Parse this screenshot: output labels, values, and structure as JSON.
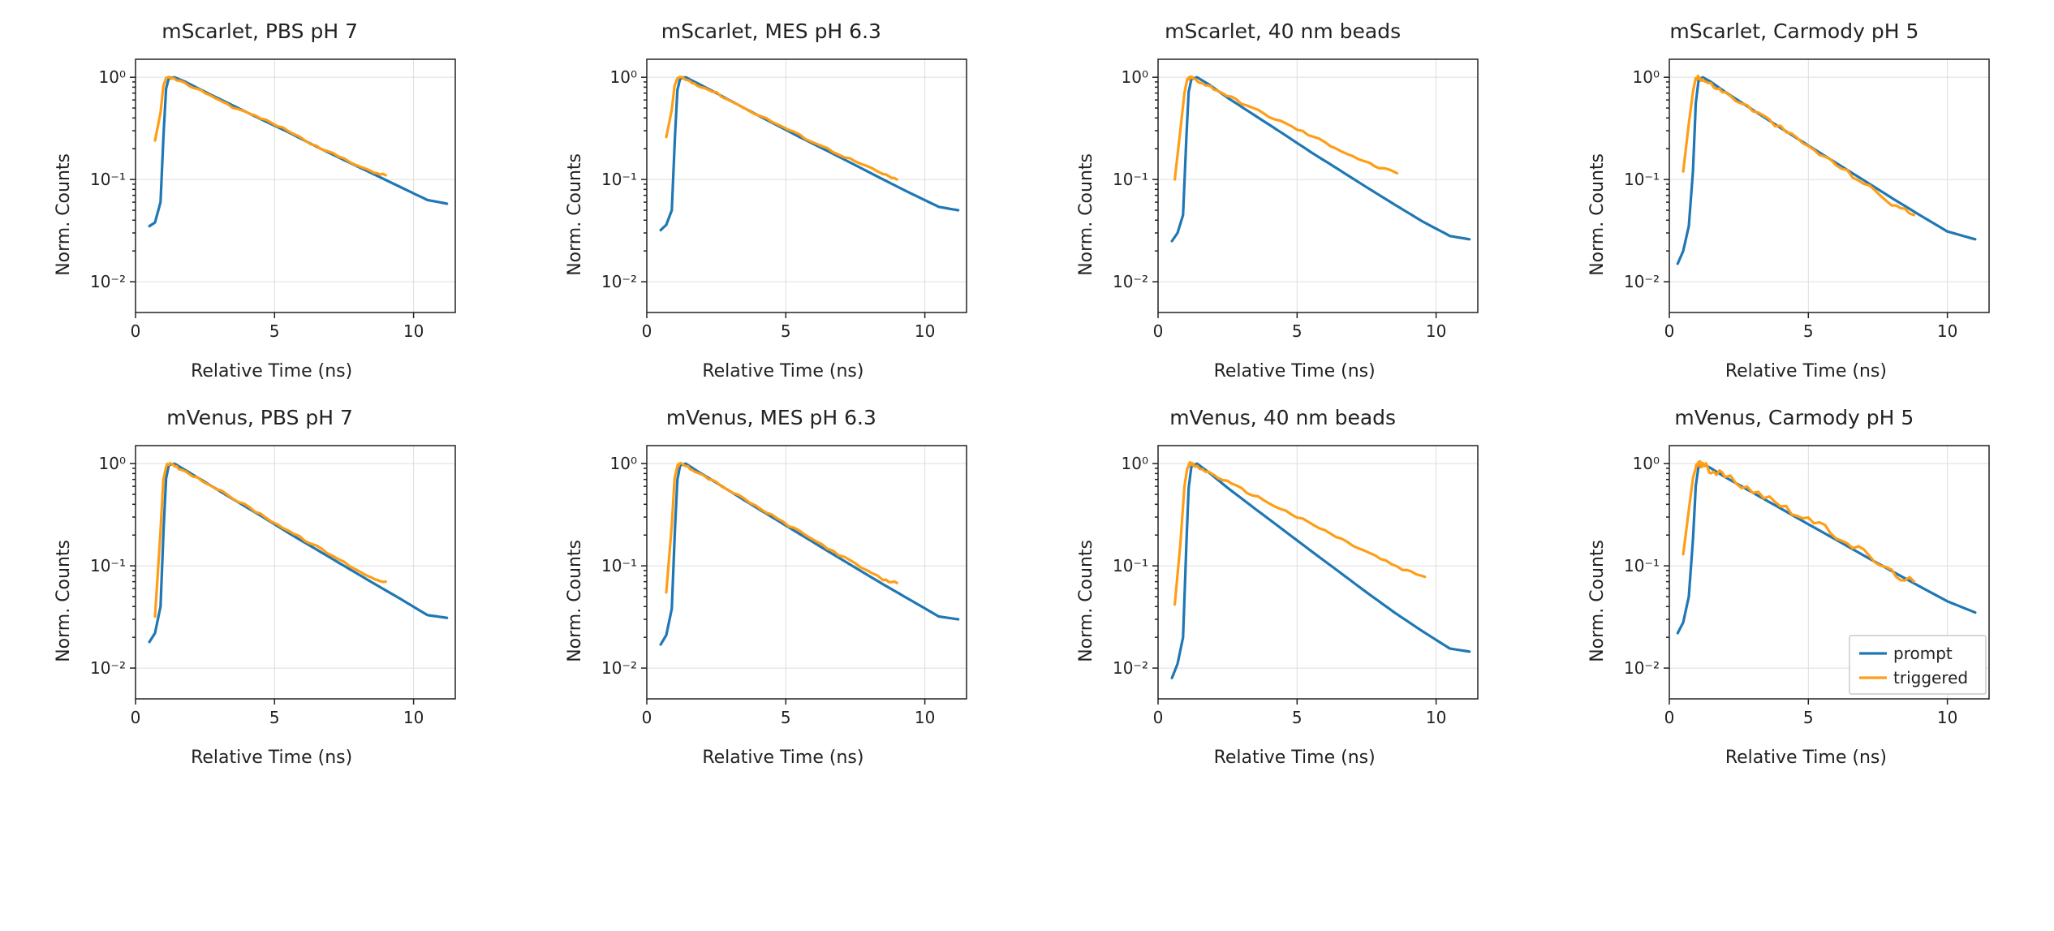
{
  "layout": {
    "rows": 2,
    "cols": 4
  },
  "common": {
    "xlabel": "Relative Time (ns)",
    "ylabel": "Norm. Counts",
    "xlim": [
      0,
      11.5
    ],
    "ylim": [
      0.005,
      1.5
    ],
    "yscale": "log",
    "xticks": [
      0,
      5,
      10
    ],
    "ytick_labels": [
      "10⁻²",
      "10⁻¹",
      "10⁰"
    ],
    "ytick_values": [
      0.01,
      0.1,
      1.0
    ]
  },
  "colors": {
    "prompt": "#1f77b4",
    "triggered": "#ff9e16"
  },
  "legend": {
    "panel_index": 7,
    "items": [
      "prompt",
      "triggered"
    ]
  },
  "chart_data": [
    {
      "title": "mScarlet, PBS pH 7",
      "type": "line",
      "xlabel": "Relative Time (ns)",
      "ylabel": "Norm. Counts",
      "xlim": [
        0,
        11.5
      ],
      "ylim": [
        0.005,
        1.5
      ],
      "yscale": "log",
      "series": [
        {
          "name": "prompt",
          "x": [
            0.5,
            0.7,
            0.9,
            1.0,
            1.1,
            1.2,
            1.4,
            1.8,
            2.5,
            3.5,
            4.5,
            5.5,
            6.5,
            7.5,
            8.5,
            9.5,
            10.5,
            11.2
          ],
          "y": [
            0.035,
            0.038,
            0.06,
            0.25,
            0.78,
            0.98,
            1.0,
            0.9,
            0.72,
            0.53,
            0.39,
            0.29,
            0.21,
            0.155,
            0.115,
            0.085,
            0.063,
            0.058
          ]
        },
        {
          "name": "triggered",
          "x": [
            0.7,
            0.9,
            1.0,
            1.1,
            1.2,
            1.4,
            1.8,
            2.5,
            3.5,
            4.5,
            5.5,
            6.5,
            7.5,
            8.5,
            9.0
          ],
          "y": [
            0.24,
            0.45,
            0.82,
            0.97,
            1.0,
            0.96,
            0.86,
            0.71,
            0.51,
            0.4,
            0.3,
            0.21,
            0.16,
            0.118,
            0.11
          ],
          "noise": 0.02
        }
      ]
    },
    {
      "title": "mScarlet, MES pH 6.3",
      "type": "line",
      "xlabel": "Relative Time (ns)",
      "ylabel": "Norm. Counts",
      "xlim": [
        0,
        11.5
      ],
      "ylim": [
        0.005,
        1.5
      ],
      "yscale": "log",
      "series": [
        {
          "name": "prompt",
          "x": [
            0.5,
            0.7,
            0.9,
            1.0,
            1.1,
            1.2,
            1.4,
            1.8,
            2.5,
            3.5,
            4.5,
            5.5,
            6.5,
            7.5,
            8.5,
            9.5,
            10.5,
            11.2
          ],
          "y": [
            0.032,
            0.036,
            0.05,
            0.22,
            0.75,
            0.97,
            1.0,
            0.88,
            0.7,
            0.5,
            0.36,
            0.26,
            0.19,
            0.138,
            0.1,
            0.073,
            0.054,
            0.05
          ]
        },
        {
          "name": "triggered",
          "x": [
            0.7,
            0.9,
            1.0,
            1.1,
            1.2,
            1.4,
            1.8,
            2.5,
            3.5,
            4.5,
            5.5,
            6.5,
            7.5,
            8.5,
            9.0
          ],
          "y": [
            0.26,
            0.48,
            0.83,
            0.97,
            1.0,
            0.95,
            0.85,
            0.7,
            0.5,
            0.37,
            0.27,
            0.2,
            0.15,
            0.113,
            0.1
          ],
          "noise": 0.025
        }
      ]
    },
    {
      "title": "mScarlet, 40 nm beads",
      "type": "line",
      "xlabel": "Relative Time (ns)",
      "ylabel": "Norm. Counts",
      "xlim": [
        0,
        11.5
      ],
      "ylim": [
        0.005,
        1.5
      ],
      "yscale": "log",
      "series": [
        {
          "name": "prompt",
          "x": [
            0.5,
            0.7,
            0.9,
            1.0,
            1.1,
            1.2,
            1.4,
            1.8,
            2.5,
            3.5,
            4.5,
            5.5,
            6.5,
            7.5,
            8.5,
            9.5,
            10.5,
            11.2
          ],
          "y": [
            0.025,
            0.03,
            0.045,
            0.2,
            0.72,
            0.96,
            1.0,
            0.86,
            0.63,
            0.42,
            0.28,
            0.185,
            0.125,
            0.084,
            0.057,
            0.039,
            0.028,
            0.026
          ]
        },
        {
          "name": "triggered",
          "x": [
            0.6,
            0.8,
            0.95,
            1.05,
            1.15,
            1.25,
            1.5,
            2.0,
            2.8,
            3.8,
            4.8,
            5.8,
            6.8,
            7.8,
            8.6
          ],
          "y": [
            0.1,
            0.3,
            0.7,
            0.94,
            1.0,
            0.98,
            0.9,
            0.78,
            0.6,
            0.44,
            0.33,
            0.245,
            0.18,
            0.135,
            0.115
          ],
          "noise": 0.03
        }
      ]
    },
    {
      "title": "mScarlet, Carmody pH 5",
      "type": "line",
      "xlabel": "Relative Time (ns)",
      "ylabel": "Norm. Counts",
      "xlim": [
        0,
        11.5
      ],
      "ylim": [
        0.005,
        1.5
      ],
      "yscale": "log",
      "series": [
        {
          "name": "prompt",
          "x": [
            0.3,
            0.5,
            0.7,
            0.85,
            0.95,
            1.05,
            1.2,
            1.5,
            2.0,
            3.0,
            4.0,
            5.0,
            6.0,
            7.0,
            8.0,
            9.0,
            10.0,
            11.0
          ],
          "y": [
            0.015,
            0.02,
            0.035,
            0.12,
            0.55,
            0.93,
            1.0,
            0.9,
            0.72,
            0.48,
            0.32,
            0.215,
            0.145,
            0.098,
            0.066,
            0.045,
            0.031,
            0.026
          ]
        },
        {
          "name": "triggered",
          "x": [
            0.5,
            0.7,
            0.85,
            0.95,
            1.05,
            1.2,
            1.5,
            2.0,
            3.0,
            4.0,
            5.0,
            6.0,
            7.0,
            8.0,
            8.8
          ],
          "y": [
            0.12,
            0.35,
            0.72,
            0.95,
            1.0,
            0.95,
            0.85,
            0.7,
            0.48,
            0.32,
            0.21,
            0.14,
            0.092,
            0.058,
            0.045
          ],
          "noise": 0.05
        }
      ]
    },
    {
      "title": "mVenus, PBS pH 7",
      "type": "line",
      "xlabel": "Relative Time (ns)",
      "ylabel": "Norm. Counts",
      "xlim": [
        0,
        11.5
      ],
      "ylim": [
        0.005,
        1.5
      ],
      "yscale": "log",
      "series": [
        {
          "name": "prompt",
          "x": [
            0.5,
            0.7,
            0.9,
            1.0,
            1.1,
            1.2,
            1.4,
            1.8,
            2.5,
            3.5,
            4.5,
            5.5,
            6.5,
            7.5,
            8.5,
            9.5,
            10.5,
            11.2
          ],
          "y": [
            0.018,
            0.022,
            0.04,
            0.2,
            0.72,
            0.97,
            1.0,
            0.86,
            0.66,
            0.45,
            0.31,
            0.21,
            0.145,
            0.1,
            0.069,
            0.048,
            0.033,
            0.031
          ]
        },
        {
          "name": "triggered",
          "x": [
            0.7,
            0.9,
            1.0,
            1.1,
            1.2,
            1.4,
            1.8,
            2.5,
            3.5,
            4.5,
            5.5,
            6.5,
            7.5,
            8.5,
            9.0
          ],
          "y": [
            0.032,
            0.22,
            0.7,
            0.95,
            1.0,
            0.95,
            0.84,
            0.66,
            0.46,
            0.32,
            0.22,
            0.155,
            0.108,
            0.076,
            0.07
          ],
          "noise": 0.025
        }
      ]
    },
    {
      "title": "mVenus, MES pH 6.3",
      "type": "line",
      "xlabel": "Relative Time (ns)",
      "ylabel": "Norm. Counts",
      "xlim": [
        0,
        11.5
      ],
      "ylim": [
        0.005,
        1.5
      ],
      "yscale": "log",
      "series": [
        {
          "name": "prompt",
          "x": [
            0.5,
            0.7,
            0.9,
            1.0,
            1.1,
            1.2,
            1.4,
            1.8,
            2.5,
            3.5,
            4.5,
            5.5,
            6.5,
            7.5,
            8.5,
            9.5,
            10.5,
            11.2
          ],
          "y": [
            0.017,
            0.021,
            0.038,
            0.19,
            0.7,
            0.96,
            1.0,
            0.85,
            0.65,
            0.44,
            0.3,
            0.205,
            0.14,
            0.096,
            0.066,
            0.046,
            0.032,
            0.03
          ]
        },
        {
          "name": "triggered",
          "x": [
            0.7,
            0.9,
            1.0,
            1.1,
            1.2,
            1.4,
            1.8,
            2.5,
            3.5,
            4.5,
            5.5,
            6.5,
            7.5,
            8.5,
            9.0
          ],
          "y": [
            0.055,
            0.25,
            0.72,
            0.95,
            1.0,
            0.95,
            0.83,
            0.65,
            0.45,
            0.31,
            0.215,
            0.15,
            0.104,
            0.073,
            0.068
          ],
          "noise": 0.025
        }
      ]
    },
    {
      "title": "mVenus, 40 nm beads",
      "type": "line",
      "xlabel": "Relative Time (ns)",
      "ylabel": "Norm. Counts",
      "xlim": [
        0,
        11.5
      ],
      "ylim": [
        0.005,
        1.5
      ],
      "yscale": "log",
      "series": [
        {
          "name": "prompt",
          "x": [
            0.5,
            0.7,
            0.9,
            1.0,
            1.1,
            1.2,
            1.4,
            1.8,
            2.5,
            3.5,
            4.5,
            5.5,
            6.5,
            7.5,
            8.5,
            9.5,
            10.5,
            11.2
          ],
          "y": [
            0.008,
            0.011,
            0.02,
            0.12,
            0.58,
            0.94,
            1.0,
            0.83,
            0.58,
            0.36,
            0.225,
            0.14,
            0.088,
            0.055,
            0.035,
            0.023,
            0.0155,
            0.0145
          ]
        },
        {
          "name": "triggered",
          "x": [
            0.6,
            0.8,
            0.95,
            1.05,
            1.15,
            1.25,
            1.5,
            2.0,
            2.8,
            3.8,
            4.8,
            5.8,
            6.8,
            7.8,
            8.8,
            9.6
          ],
          "y": [
            0.042,
            0.16,
            0.6,
            0.92,
            1.0,
            0.98,
            0.9,
            0.78,
            0.6,
            0.44,
            0.32,
            0.235,
            0.17,
            0.125,
            0.092,
            0.078
          ],
          "noise": 0.03
        }
      ]
    },
    {
      "title": "mVenus, Carmody pH 5",
      "type": "line",
      "xlabel": "Relative Time (ns)",
      "ylabel": "Norm. Counts",
      "xlim": [
        0,
        11.5
      ],
      "ylim": [
        0.005,
        1.5
      ],
      "yscale": "log",
      "series": [
        {
          "name": "prompt",
          "x": [
            0.3,
            0.5,
            0.7,
            0.85,
            0.95,
            1.05,
            1.2,
            1.5,
            2.0,
            3.0,
            4.0,
            5.0,
            6.0,
            7.0,
            8.0,
            9.0,
            10.0,
            11.0
          ],
          "y": [
            0.022,
            0.028,
            0.05,
            0.18,
            0.6,
            0.94,
            1.0,
            0.9,
            0.74,
            0.52,
            0.365,
            0.255,
            0.18,
            0.126,
            0.089,
            0.063,
            0.045,
            0.035
          ]
        },
        {
          "name": "triggered",
          "x": [
            0.5,
            0.7,
            0.85,
            0.95,
            1.05,
            1.2,
            1.5,
            2.0,
            3.0,
            4.0,
            5.0,
            6.0,
            7.0,
            8.0,
            8.8
          ],
          "y": [
            0.13,
            0.35,
            0.72,
            0.95,
            1.0,
            0.96,
            0.88,
            0.76,
            0.56,
            0.4,
            0.285,
            0.2,
            0.135,
            0.085,
            0.07
          ],
          "noise": 0.09
        }
      ]
    }
  ]
}
